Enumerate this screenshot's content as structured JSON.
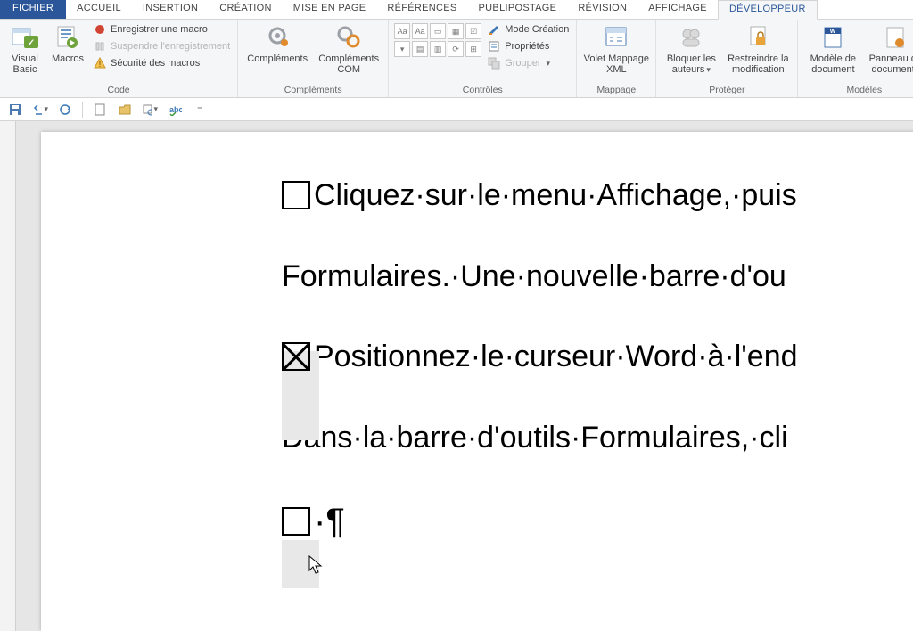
{
  "tabs": {
    "file": "FICHIER",
    "items": [
      "ACCUEIL",
      "INSERTION",
      "CRÉATION",
      "MISE EN PAGE",
      "RÉFÉRENCES",
      "PUBLIPOSTAGE",
      "RÉVISION",
      "AFFICHAGE",
      "DÉVELOPPEUR"
    ],
    "active": "DÉVELOPPEUR"
  },
  "ribbon": {
    "code": {
      "visual_basic": "Visual Basic",
      "macros": "Macros",
      "record": "Enregistrer une macro",
      "pause": "Suspendre l'enregistrement",
      "security": "Sécurité des macros",
      "label": "Code"
    },
    "complements": {
      "btn1": "Compléments",
      "btn2": "Compléments COM",
      "label": "Compléments"
    },
    "controles": {
      "design": "Mode Création",
      "props": "Propriétés",
      "group": "Grouper",
      "aa1": "Aa",
      "aa2": "Aa",
      "label": "Contrôles"
    },
    "mappage": {
      "btn": "Volet Mappage XML",
      "label": "Mappage"
    },
    "proteger": {
      "block": "Bloquer les auteurs",
      "restrict": "Restreindre la modification",
      "label": "Protéger"
    },
    "modeles": {
      "template": "Modèle de document",
      "panel": "Panneau de documents",
      "label": "Modèles"
    }
  },
  "document": {
    "line1": "Cliquez·sur·le·menu·Affichage,·puis",
    "line2": "Formulaires.·Une·nouvelle·barre·d'ou",
    "line3": "Positionnez·le·curseur·Word·à·l'end",
    "line4": "Dans·la·barre·d'outils·Formulaires,·cli",
    "pilcrow": "·¶"
  }
}
